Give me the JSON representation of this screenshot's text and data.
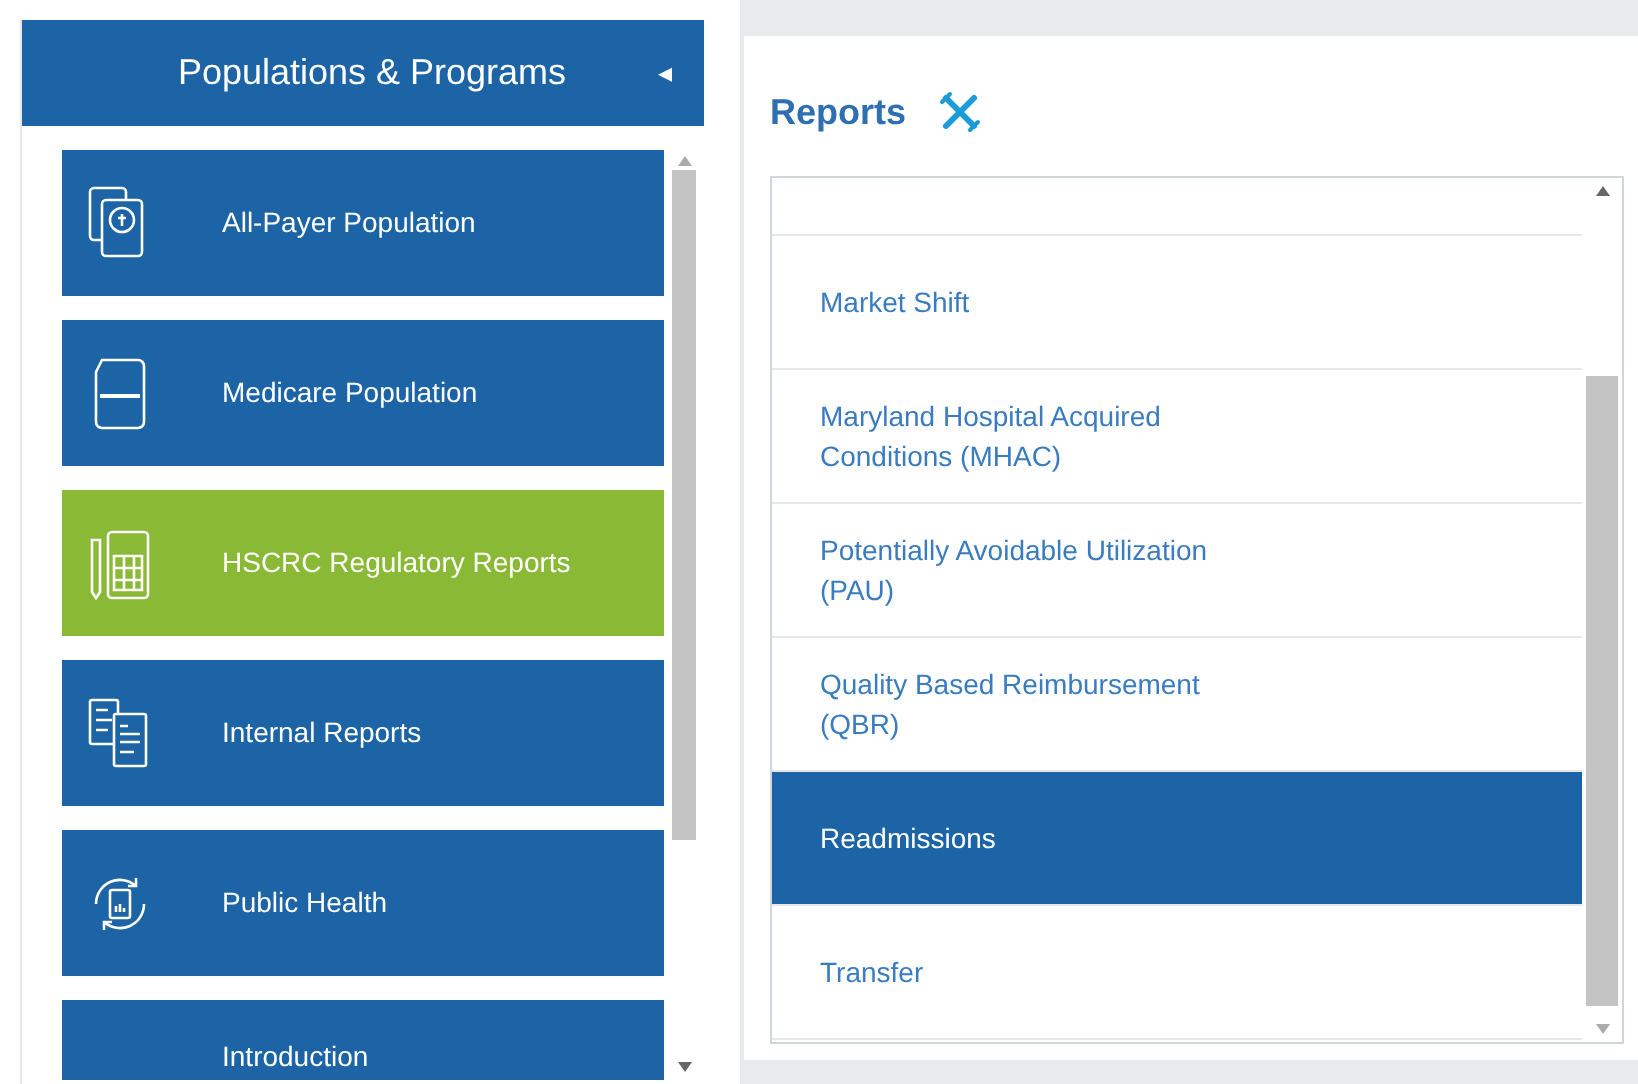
{
  "sidebar": {
    "title": "Populations & Programs",
    "collapse_glyph": "◂",
    "items": [
      {
        "label": "All-Payer Population",
        "selected": false
      },
      {
        "label": "Medicare Population",
        "selected": false
      },
      {
        "label": "HSCRC Regulatory Reports",
        "selected": true
      },
      {
        "label": "Internal Reports",
        "selected": false
      },
      {
        "label": "Public Health",
        "selected": false
      },
      {
        "label": "Introduction",
        "selected": false
      }
    ]
  },
  "reports": {
    "title": "Reports",
    "items": [
      {
        "selected": false
      },
      {
        "label": "Market Shift",
        "selected": false
      },
      {
        "label": "Maryland Hospital Acquired\nConditions (MHAC)",
        "selected": false
      },
      {
        "label": "Potentially Avoidable Utilization\n(PAU)",
        "selected": false
      },
      {
        "label": "Quality Based Reimbursement\n(QBR)",
        "selected": false
      },
      {
        "label": "Readmissions",
        "selected": true
      },
      {
        "label": "Transfer",
        "selected": false
      }
    ]
  }
}
